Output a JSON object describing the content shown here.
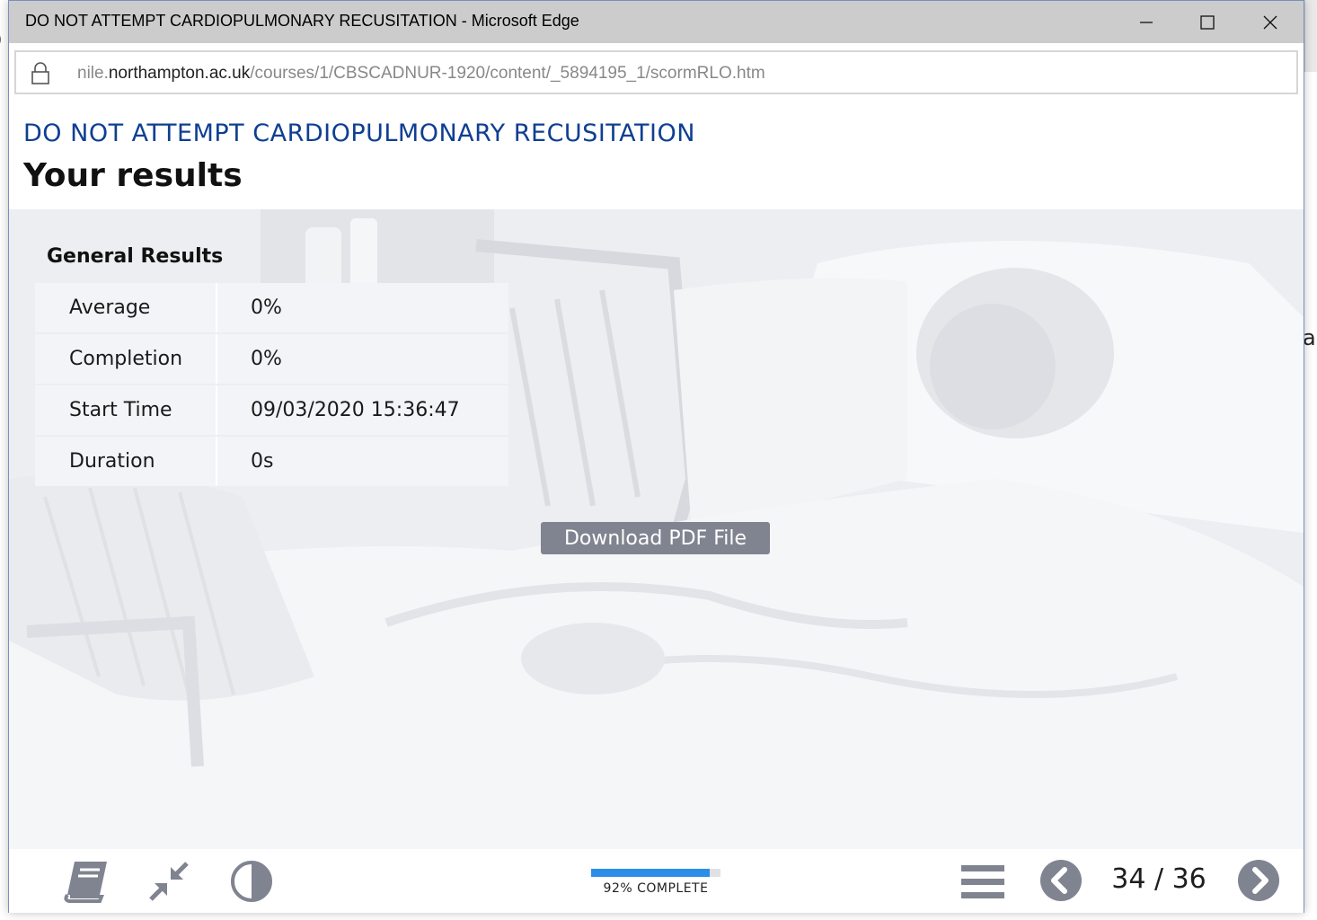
{
  "window": {
    "title": "DO NOT ATTEMPT CARDIOPULMONARY RECUSITATION - Microsoft Edge",
    "controls": {
      "minimize_icon": "minimize-icon",
      "maximize_icon": "maximize-icon",
      "close_icon": "close-icon"
    }
  },
  "address_bar": {
    "url_prefix": "nile.",
    "url_host": "northampton.ac.uk",
    "url_path": "/courses/1/CBSCADNUR-1920/content/_5894195_1/scormRLO.htm",
    "lock_icon": "lock-icon"
  },
  "desktop": {
    "left_edge_glyph": ")",
    "right_edge_glyph": "al"
  },
  "header": {
    "course_title": "DO NOT ATTEMPT CARDIOPULMONARY RECUSITATION",
    "page_title": "Your results"
  },
  "results": {
    "heading": "General Results",
    "rows": [
      {
        "label": "Average",
        "value": "0%"
      },
      {
        "label": "Completion",
        "value": "0%"
      },
      {
        "label": "Start Time",
        "value": "09/03/2020 15:36:47"
      },
      {
        "label": "Duration",
        "value": "0s"
      }
    ]
  },
  "download_button": {
    "label": "Download PDF File"
  },
  "footer": {
    "icons": [
      "book-icon",
      "shrink-arrows-icon",
      "contrast-icon",
      "hamburger-menu-icon",
      "chevron-left-icon",
      "chevron-right-icon"
    ],
    "progress": {
      "percent": 92,
      "label": "92% COMPLETE"
    },
    "page_counter": "34 / 36"
  },
  "colors": {
    "course_title": "#0e3f92",
    "progress_fill": "#2b8ee8",
    "button_bg": "#808490",
    "icon_gray": "#808490",
    "titlebar_bg": "#cccccc"
  }
}
